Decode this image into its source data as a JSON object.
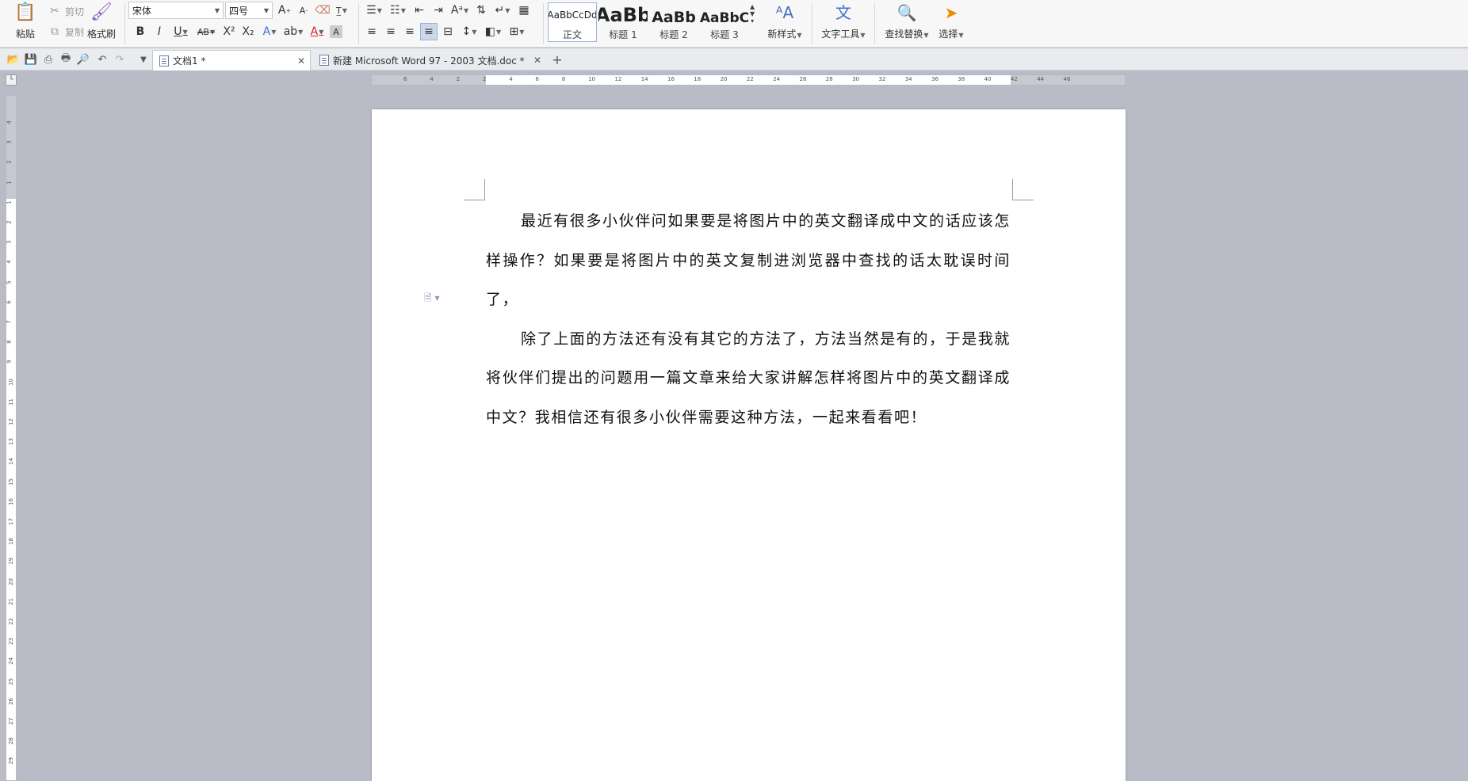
{
  "toolbar": {
    "clipboard": {
      "paste": "粘贴",
      "cut": "剪切",
      "copy": "复制",
      "format_painter": "格式刷"
    },
    "font": {
      "family": "宋体",
      "size": "四号"
    },
    "styles": [
      {
        "sample": "AaBbCcDd",
        "name": "正文"
      },
      {
        "sample": "AaBb",
        "name": "标题 1"
      },
      {
        "sample": "AaBb",
        "name": "标题 2"
      },
      {
        "sample": "AaBbC",
        "name": "标题 3"
      }
    ],
    "new_style": "新样式",
    "text_tools": "文字工具",
    "find_replace": "查找替换",
    "select": "选择"
  },
  "tabs": [
    {
      "title": "文档1 *"
    },
    {
      "title": "新建 Microsoft Word 97 - 2003 文档.doc *"
    }
  ],
  "rulers": {
    "horizontal_ticks": [
      "6",
      "4",
      "2",
      "2",
      "4",
      "6",
      "8",
      "10",
      "12",
      "14",
      "16",
      "18",
      "20",
      "22",
      "24",
      "26",
      "28",
      "30",
      "32",
      "34",
      "36",
      "38",
      "40",
      "42",
      "44",
      "46"
    ],
    "vertical_ticks": [
      "4",
      "3",
      "2",
      "1",
      "1",
      "2",
      "3",
      "4",
      "5",
      "6",
      "7",
      "8",
      "9",
      "10",
      "11",
      "12",
      "13",
      "14",
      "15",
      "16",
      "17",
      "18",
      "19",
      "20",
      "21",
      "22",
      "23",
      "24",
      "25",
      "26",
      "27",
      "28",
      "29"
    ]
  },
  "document": {
    "paragraphs": [
      "最近有很多小伙伴问如果要是将图片中的英文翻译成中文的话应该怎样操作？如果要是将图片中的英文复制进浏览器中查找的话太耽误时间了，",
      "除了上面的方法还有没有其它的方法了，方法当然是有的，于是我就将伙伴们提出的问题用一篇文章来给大家讲解怎样将图片中的英文翻译成中文？我相信还有很多小伙伴需要这种方法，一起来看看吧！"
    ]
  }
}
